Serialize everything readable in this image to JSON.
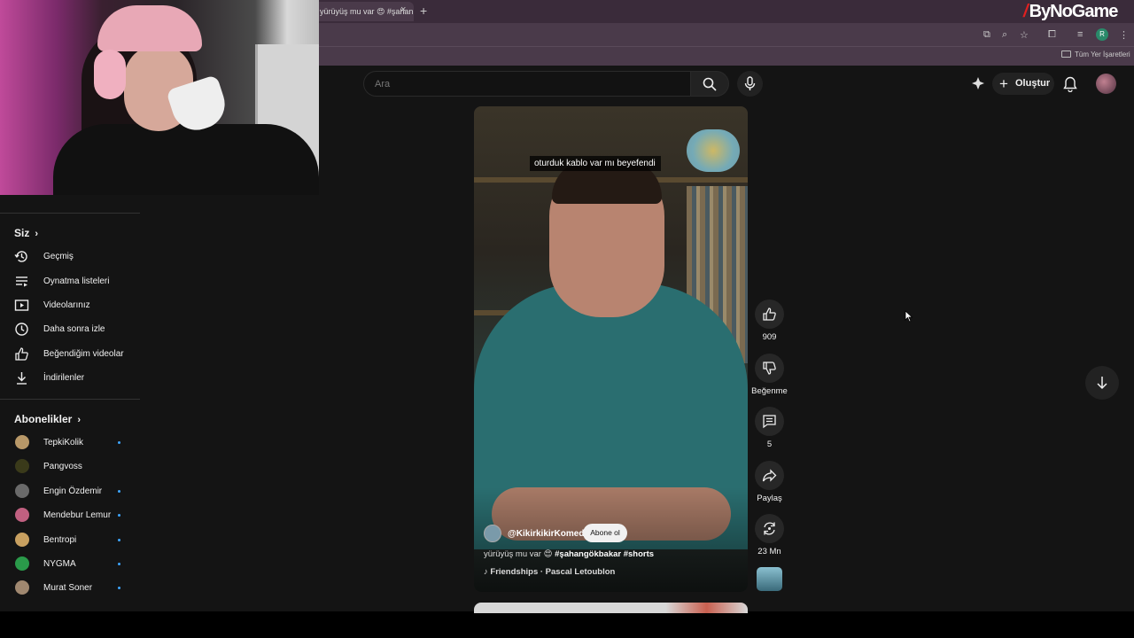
{
  "browser": {
    "tab_title": "yürüyüş mu var 😍 #şahan",
    "tab_close": "×",
    "tab_new": "+",
    "profile_initial": "R",
    "bookmarks_all": "Tüm Yer İşaretleri"
  },
  "watermark": {
    "text": "ByNoGame"
  },
  "masthead": {
    "search_placeholder": "Ara",
    "create_label": "Oluştur",
    "create_plus": "+"
  },
  "sidebar": {
    "truncated_item": "",
    "you_title": "Siz",
    "you_items": [
      {
        "label": "Geçmiş",
        "icon": "history-icon"
      },
      {
        "label": "Oynatma listeleri",
        "icon": "playlist-icon"
      },
      {
        "label": "Videolarınız",
        "icon": "your-videos-icon"
      },
      {
        "label": "Daha sonra izle",
        "icon": "watch-later-icon"
      },
      {
        "label": "Beğendiğim videolar",
        "icon": "liked-icon"
      },
      {
        "label": "İndirilenler",
        "icon": "download-icon"
      }
    ],
    "subs_title": "Abonelikler",
    "chevron": "›",
    "subscriptions": [
      {
        "name": "TepkiKolik",
        "color": "#b89868",
        "live": true
      },
      {
        "name": "Pangvoss",
        "color": "#3a3a1a",
        "live": false
      },
      {
        "name": "Engin Özdemir",
        "color": "#6a6a6a",
        "live": true
      },
      {
        "name": "Mendebur Lemur",
        "color": "#c06080",
        "live": true
      },
      {
        "name": "Bentropi",
        "color": "#c8a060",
        "live": true
      },
      {
        "name": "NYGMA",
        "color": "#2a9a4a",
        "live": true
      },
      {
        "name": "Murat Soner",
        "color": "#a08870",
        "live": true
      }
    ]
  },
  "short": {
    "caption": "oturduk kablo var mı beyefendi",
    "channel": "@KikirkikirKomedi",
    "subscribe": "Abone ol",
    "title_plain": "yürüyüş mu var 😍 ",
    "title_tags": "#şahangökbakar #shorts",
    "music": "♪ Friendships · Pascal Letoublon"
  },
  "actions": {
    "likes": "909",
    "dislike": "Beğenme",
    "comments": "5",
    "share": "Paylaş",
    "remix": "23 Mn"
  },
  "colors": {
    "accent_live": "#3ea6ff",
    "page_bg": "#141414"
  }
}
